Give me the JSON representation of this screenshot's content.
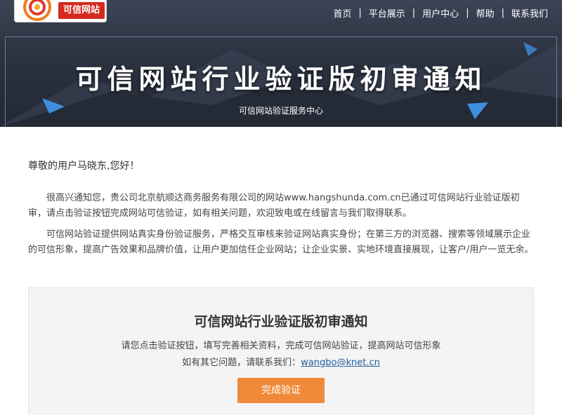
{
  "logo": {
    "text": "可信网站",
    "icon": "swirl-logo-icon"
  },
  "nav": {
    "items": [
      "首页",
      "平台展示",
      "用户中心",
      "帮助",
      "联系我们"
    ],
    "separator": "|"
  },
  "hero": {
    "title": "可信网站行业验证版初审通知",
    "subtitle": "可信网站验证服务中心"
  },
  "letter": {
    "greeting": "尊敬的用户马晓东,您好！",
    "paragraph1": "很高兴通知您，贵公司北京航顺达商务服务有限公司的网站www.hangshunda.com.cn已通过可信网站行业验证版初审，请点击验证按钮完成网站可信验证，如有相关问题，欢迎致电或在线留言与我们取得联系。",
    "paragraph2": "可信网站验证提供网站真实身份验证服务，严格交互审核来验证网站真实身份；在第三方的浏览器、搜索等领域展示企业的可信形象，提高广告效果和品牌价值，让用户更加信任企业网站；让企业实景、实地环境直接展现，让客户/用户一览无余。"
  },
  "notice": {
    "title": "可信网站行业验证版初审通知",
    "line1": "请您点击验证按钮，填写完善相关资料，完成可信网站验证，提高网站可信形象",
    "line2_prefix": "如有其它问题，请联系我们：",
    "email": "wangbo@knet.cn",
    "button": "完成验证"
  },
  "colors": {
    "banner": "#2b3240",
    "brand_red": "#d42a20",
    "accent_orange": "#f08a3a",
    "link": "#1f5d9e"
  }
}
